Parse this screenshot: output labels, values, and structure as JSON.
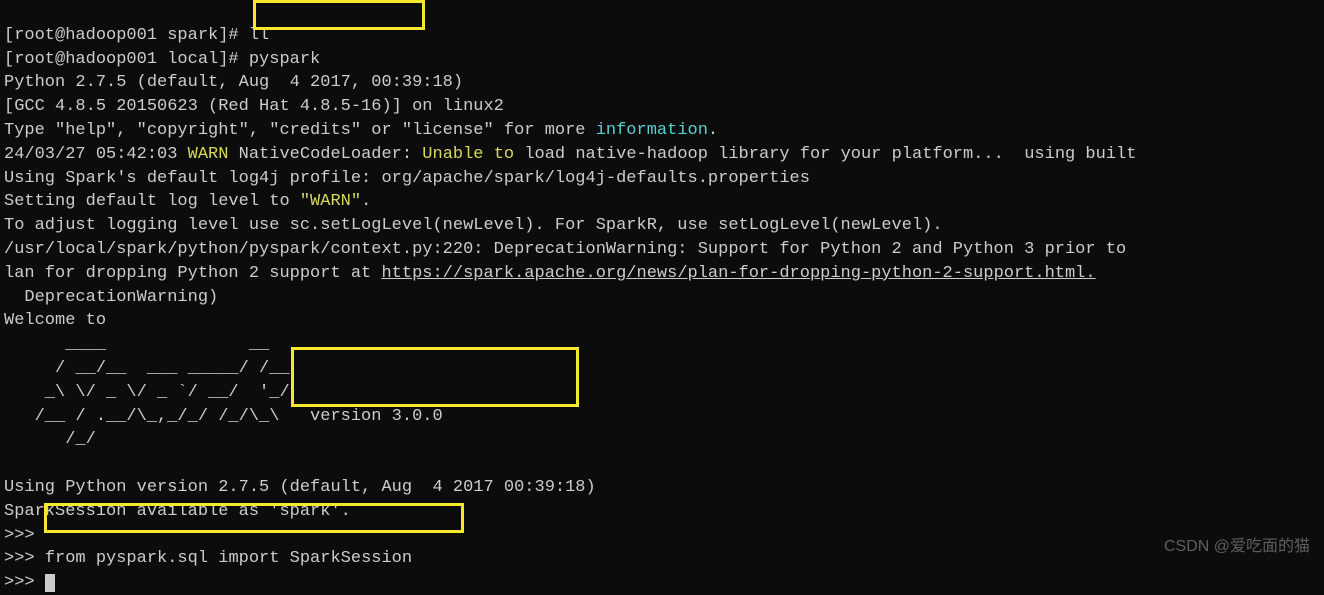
{
  "line0_prompt": "[root@hadoop001 spark]# ",
  "line0_cmd": "ll",
  "line1_prompt": "[root@hadoop001 local]# ",
  "line1_cmd": "pyspark",
  "line2": "Python 2.7.5 (default, Aug  4 2017, 00:39:18)",
  "line3": "[GCC 4.8.5 20150623 (Red Hat 4.8.5-16)] on linux2",
  "line4_a": "Type \"help\", \"copyright\", \"credits\" or \"license\" for more ",
  "line4_info": "information",
  "line4_b": ".",
  "line5_a": "24/03/27 05:42:03 ",
  "line5_warn": "WARN",
  "line5_b": " NativeCodeLoader: ",
  "line5_unable": "Unable to",
  "line5_c": " load native-hadoop library for your platform...  using built",
  "line6": "Using Spark's default log4j profile: org/apache/spark/log4j-defaults.properties",
  "line7_a": "Setting default log level to ",
  "line7_b": "\"WARN\"",
  "line7_c": ".",
  "line8": "To adjust logging level use sc.setLogLevel(newLevel). For SparkR, use setLogLevel(newLevel).",
  "line9": "/usr/local/spark/python/pyspark/context.py:220: DeprecationWarning: Support for Python 2 and Python 3 prior to",
  "line10_a": "lan for dropping Python 2 support at ",
  "line10_link": "https://spark.apache.org/news/plan-for-dropping-python-2-support.html.",
  "line11": "  DeprecationWarning)",
  "line12": "Welcome to",
  "art1": "      ____              __",
  "art2": "     / __/__  ___ _____/ /__",
  "art3": "    _\\ \\/ _ \\/ _ `/ __/  '_/",
  "art4": "   /__ / .__/\\_,_/_/ /_/\\_\\   version 3.0.0",
  "art5": "      /_/",
  "line_py": "Using Python version 2.7.5 (default, Aug  4 2017 00:39:18)",
  "line_ss": "SparkSession available as 'spark'.",
  "prompt1": ">>> ",
  "import_cmd": "from pyspark.sql import SparkSession",
  "prompt2": ">>> ",
  "prompt3": ">>> ",
  "watermark": "CSDN @爱吃面的猫"
}
